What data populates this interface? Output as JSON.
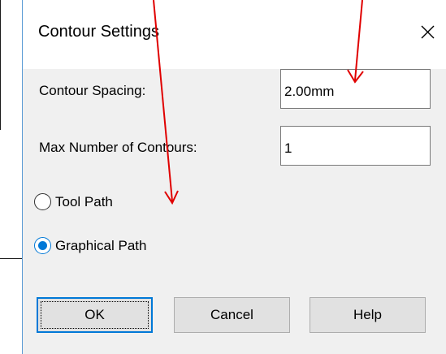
{
  "dialog": {
    "title": "Contour Settings",
    "close_icon": "close-icon",
    "contour_spacing": {
      "label": "Contour Spacing:",
      "value": "2.00mm"
    },
    "max_contours": {
      "label": "Max Number of Contours:",
      "value": "1"
    },
    "path_options": [
      {
        "label": "Tool Path",
        "checked": false
      },
      {
        "label": "Graphical Path",
        "checked": true
      }
    ],
    "buttons": {
      "ok": "OK",
      "cancel": "Cancel",
      "help": "Help"
    }
  },
  "annotations": {
    "arrow_color": "#e00000"
  },
  "colors": {
    "accent": "#0078d7",
    "dialog_bg": "#f0f0f0"
  }
}
